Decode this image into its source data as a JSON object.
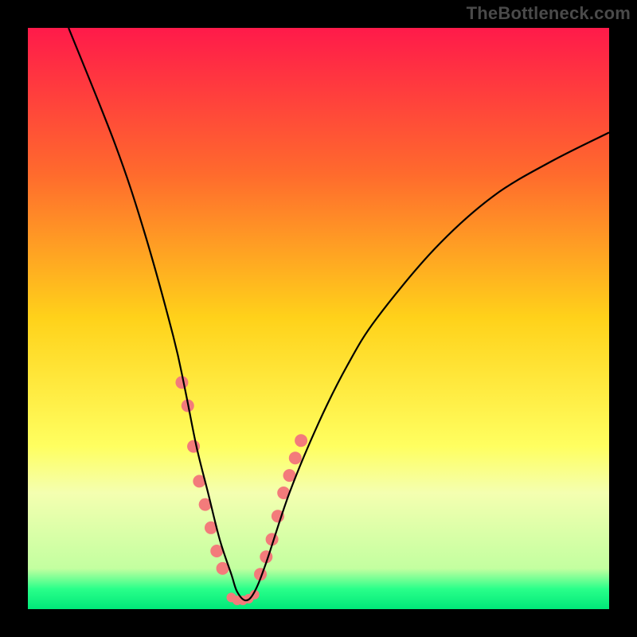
{
  "watermark": "TheBottleneck.com",
  "chart_data": {
    "type": "line",
    "title": "",
    "xlabel": "",
    "ylabel": "",
    "xlim": [
      0,
      100
    ],
    "ylim": [
      0,
      100
    ],
    "grid": false,
    "legend_position": "none",
    "gradient_stops": [
      {
        "offset": 0.0,
        "color": "#ff1a4a"
      },
      {
        "offset": 0.25,
        "color": "#ff6a2d"
      },
      {
        "offset": 0.5,
        "color": "#ffd21a"
      },
      {
        "offset": 0.72,
        "color": "#ffff60"
      },
      {
        "offset": 0.8,
        "color": "#f4ffb0"
      },
      {
        "offset": 0.93,
        "color": "#c3ffa0"
      },
      {
        "offset": 0.965,
        "color": "#2aff8a"
      },
      {
        "offset": 1.0,
        "color": "#00e879"
      }
    ],
    "series": [
      {
        "name": "bottleneck-curve",
        "x": [
          7,
          15,
          20,
          25,
          27,
          29,
          31,
          33,
          35,
          36,
          37.5,
          39,
          41,
          45,
          50,
          55,
          60,
          70,
          80,
          90,
          100
        ],
        "y": [
          100,
          80,
          65,
          47,
          38,
          28,
          20,
          12,
          6,
          3,
          1.5,
          3,
          8,
          20,
          32,
          42,
          50,
          62,
          71,
          77,
          82
        ]
      }
    ],
    "highlights": [
      {
        "name": "left-cluster",
        "x": [
          26.5,
          27.5,
          28.5,
          29.5,
          30.5,
          31.5,
          32.5,
          33.5
        ],
        "y": [
          39,
          35,
          28,
          22,
          18,
          14,
          10,
          7
        ]
      },
      {
        "name": "right-cluster",
        "x": [
          40,
          41,
          42,
          43,
          44,
          45,
          46,
          47
        ],
        "y": [
          6,
          9,
          12,
          16,
          20,
          23,
          26,
          29
        ]
      },
      {
        "name": "valley",
        "x": [
          35,
          36,
          37,
          38,
          39
        ],
        "y": [
          2,
          1.5,
          1.5,
          1.8,
          2.5
        ]
      }
    ],
    "highlight_color": "#f37b7b",
    "curve_color": "#000000",
    "curve_width": 2.2
  }
}
